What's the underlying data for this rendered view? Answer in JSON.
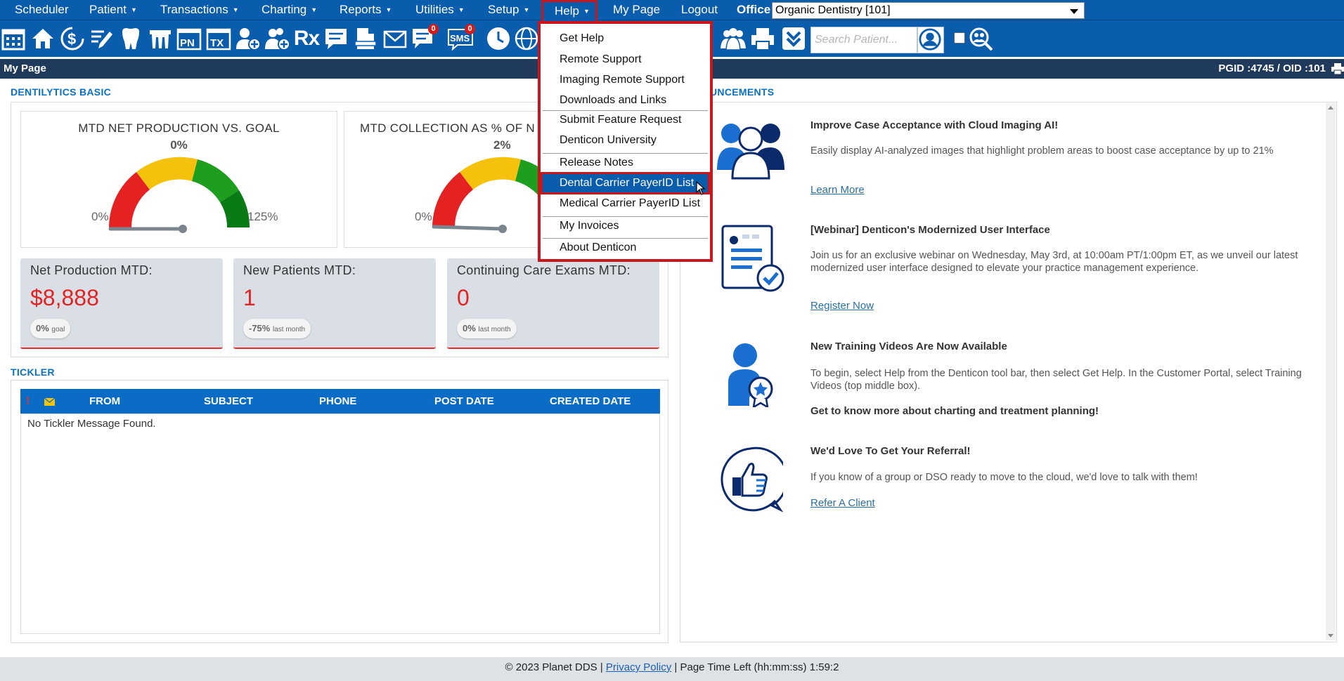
{
  "nav": {
    "items": [
      {
        "label": "Scheduler",
        "caret": false
      },
      {
        "label": "Patient",
        "caret": true
      },
      {
        "label": "Transactions",
        "caret": true
      },
      {
        "label": "Charting",
        "caret": true
      },
      {
        "label": "Reports",
        "caret": true
      },
      {
        "label": "Utilities",
        "caret": true
      },
      {
        "label": "Setup",
        "caret": true
      }
    ],
    "help": "Help",
    "mypage": "My Page",
    "logout": "Logout",
    "office_label": "Office",
    "office_value": "Organic Dentistry [101]"
  },
  "toolbar": {
    "pn": "PN",
    "tx": "TX",
    "rx": "Rx",
    "sms": "SMS",
    "messages_badge": "0",
    "sms_badge": "0",
    "search_placeholder": "Search Patient..."
  },
  "page": {
    "title": "My Page",
    "ids": "PGID :4745  /  OID :101"
  },
  "dentilytics": {
    "label": "DENTILYTICS BASIC",
    "gauges": [
      {
        "title": "MTD NET PRODUCTION VS. GOAL",
        "pct": "0%",
        "min": "0%",
        "max": "125%"
      },
      {
        "title": "MTD COLLECTION AS % OF N",
        "pct": "2%",
        "min": "0%",
        "max": ""
      }
    ],
    "stats": [
      {
        "label": "Net Production MTD:",
        "value": "$8,888",
        "pill_value": "0%",
        "pill_sub": "goal"
      },
      {
        "label": "New Patients MTD:",
        "value": "1",
        "pill_value": "-75%",
        "pill_sub": "last month"
      },
      {
        "label": "Continuing Care Exams MTD:",
        "value": "0",
        "pill_value": "0%",
        "pill_sub": "last month"
      }
    ]
  },
  "tickler": {
    "label": "TICKLER",
    "columns": [
      "FROM",
      "SUBJECT",
      "PHONE",
      "POST DATE",
      "CREATED DATE"
    ],
    "flag": "!",
    "empty": "No Tickler Message Found."
  },
  "announcements": {
    "label": "UNCEMENTS",
    "items": [
      {
        "title": "Improve Case Acceptance with Cloud Imaging AI!",
        "text": "Easily display AI-analyzed images that highlight problem areas to boost case acceptance by up to 21%",
        "link": "Learn More"
      },
      {
        "title": "[Webinar] Denticon's Modernized User Interface",
        "text": "Join us for an exclusive webinar on Wednesday, May 3rd, at 10:00am PT/1:00pm ET, as we unveil our latest modernized user interface designed to elevate your practice management experience.",
        "link": "Register Now"
      },
      {
        "title": "New Training Videos Are Now Available",
        "text": "To begin, select Help from the Denticon tool bar, then select Get Help. In the Customer Portal, select Training Videos (top middle box).",
        "extra": "Get to know more about charting and treatment planning!"
      },
      {
        "title": "We'd Love To Get Your Referral!",
        "text": "If you know of a group or DSO ready to move to the cloud, we'd love to talk with them!",
        "link": "Refer A Client"
      }
    ]
  },
  "help_menu": {
    "items": [
      "Get Help",
      "Remote Support",
      "Imaging Remote Support",
      "Downloads and Links",
      "Submit Feature Request",
      "Denticon University",
      "Release Notes",
      "Dental Carrier PayerID List",
      "Medical Carrier PayerID List",
      "My Invoices",
      "About Denticon"
    ],
    "active": "Dental Carrier PayerID List"
  },
  "footer": {
    "copyright": "© 2023 Planet DDS | ",
    "privacy": "Privacy Policy",
    "time_left": " |  Page Time Left (hh:mm:ss) 1:59:2"
  },
  "colors": {
    "nav_blue": "#0a5cad",
    "page_header": "#203a5c",
    "accent_red": "#e02424",
    "highlight_border": "#c8161d",
    "section_label": "#0a70c0"
  }
}
